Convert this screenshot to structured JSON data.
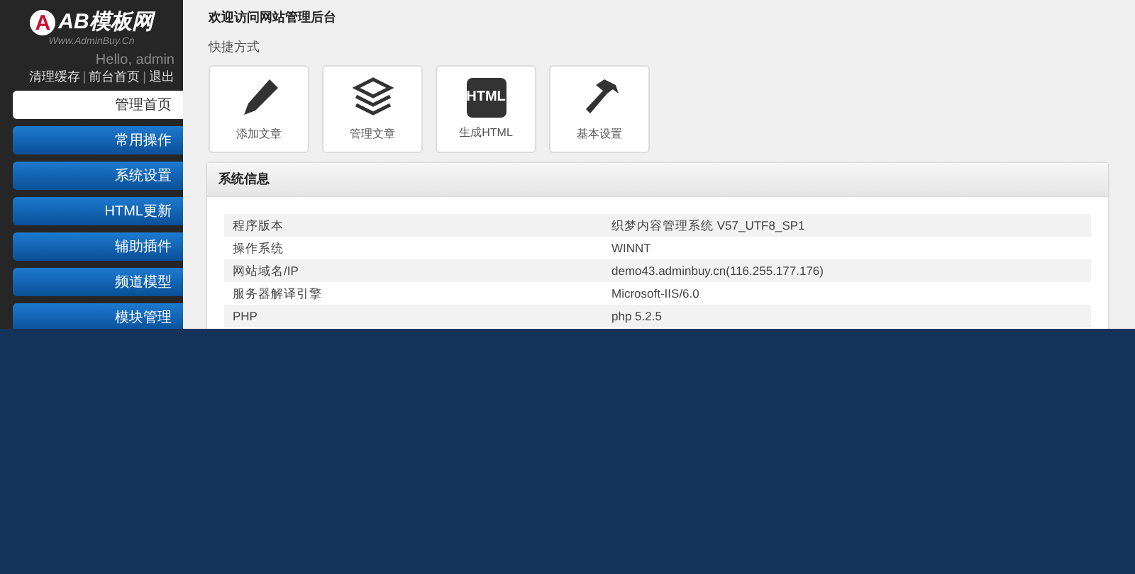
{
  "sidebar": {
    "logo": {
      "mark": "A",
      "name": "AB模板网",
      "url": "Www.AdminBuy.Cn"
    },
    "greeting": "Hello, admin",
    "links": [
      "清理缓存",
      "前台首页",
      "退出"
    ],
    "separator": "|",
    "items": [
      {
        "label": "管理首页",
        "selected": true
      },
      {
        "label": "常用操作",
        "selected": false
      },
      {
        "label": "系统设置",
        "selected": false
      },
      {
        "label": "HTML更新",
        "selected": false
      },
      {
        "label": "辅助插件",
        "selected": false
      },
      {
        "label": "频道模型",
        "selected": false
      },
      {
        "label": "模块管理",
        "selected": false
      }
    ]
  },
  "main": {
    "title": "欢迎访问网站管理后台",
    "shortcuts_title": "快捷方式",
    "shortcuts": [
      {
        "kind": "pencil",
        "label": "添加文章"
      },
      {
        "kind": "layers",
        "label": "管理文章"
      },
      {
        "kind": "html",
        "label": "生成HTML",
        "badge": "HTML"
      },
      {
        "kind": "hammer",
        "label": "基本设置"
      }
    ],
    "panel": {
      "title": "系统信息",
      "rows": [
        [
          "程序版本",
          "织梦内容管理系统 V57_UTF8_SP1"
        ],
        [
          "操作系统",
          "WINNT"
        ],
        [
          "网站域名/IP",
          "demo43.adminbuy.cn(116.255.177.176)"
        ],
        [
          "服务器解译引擎",
          "Microsoft-IIS/6.0"
        ],
        [
          "PHP",
          "php 5.2.5"
        ]
      ]
    }
  }
}
